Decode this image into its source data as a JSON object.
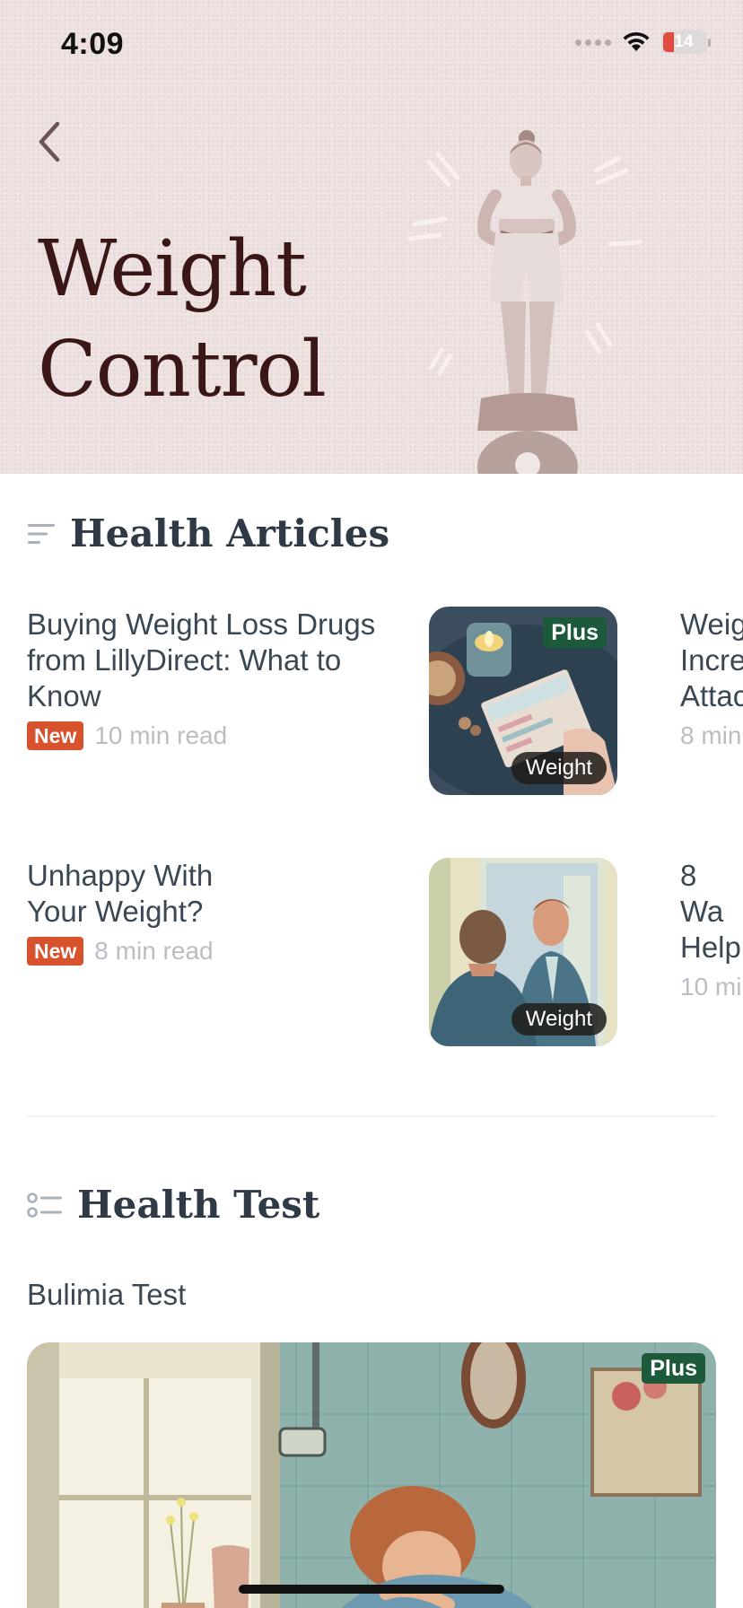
{
  "status_bar": {
    "time": "4:09",
    "battery": "14"
  },
  "header": {
    "title_line1": "Weight",
    "title_line2": "Control"
  },
  "articles_section": {
    "title": "Health Articles",
    "items": [
      {
        "title": "Buying Weight Loss Drugs from LillyDirect: What to Know",
        "badge": "New",
        "read_time": "10 min read",
        "plus": "Plus",
        "tag": "Weight"
      },
      {
        "title": "Unhappy With Your Weight?",
        "badge": "New",
        "read_time": "8 min read",
        "tag": "Weight"
      }
    ],
    "peek_items": [
      {
        "title": "Weig Incre Attac",
        "read_time": "8 min"
      },
      {
        "title": "8 Wa Help",
        "read_time": "10 mi"
      }
    ]
  },
  "test_section": {
    "title": "Health Test",
    "subtitle": "Bulimia Test",
    "plus": "Plus"
  },
  "colors": {
    "accent_new": "#d6532d",
    "plus_green": "#1d5a3c",
    "hero_bg": "#ede2e0",
    "title_dark": "#3a1616"
  }
}
